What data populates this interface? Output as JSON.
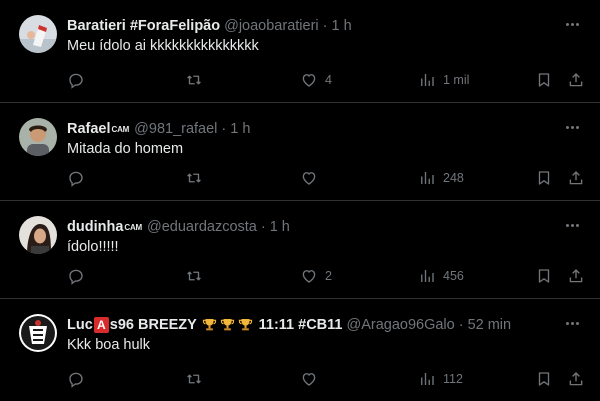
{
  "tweets": [
    {
      "name": "Baratieri #ForaFelipão",
      "badge": "",
      "handle": "@joaobaratieri",
      "separator": "·",
      "time": "1 h",
      "text": "Meu ídolo ai kkkkkkkkkkkkkkk",
      "likes": "4",
      "views": "1 mil",
      "replies": "",
      "retweets": ""
    },
    {
      "name": "Rafael",
      "badge": "CAM",
      "handle": "@981_rafael",
      "separator": "·",
      "time": "1 h",
      "text": "Mitada do homem",
      "likes": "",
      "views": "248",
      "replies": "",
      "retweets": ""
    },
    {
      "name": "dudinha",
      "badge": "CAM",
      "handle": "@eduardazcosta",
      "separator": "·",
      "time": "1 h",
      "text": "ídolo!!!!!",
      "likes": "2",
      "views": "456",
      "replies": "",
      "retweets": ""
    },
    {
      "name_part1": "Luc",
      "name_red_letter": "A",
      "name_part2": "s96 BREEZY",
      "name_part3": "11:11 #CB11",
      "handle": "@Aragao96Galo",
      "separator": "·",
      "time": "52 min",
      "text": "Kkk boa hulk",
      "likes": "",
      "views": "112",
      "replies": "",
      "retweets": ""
    }
  ],
  "icons": {
    "reply": "reply-icon",
    "retweet": "retweet-icon",
    "like": "heart-icon",
    "views": "views-icon",
    "bookmark": "bookmark-icon",
    "share": "share-icon",
    "more": "more-icon",
    "trophy": "trophy-icon"
  },
  "colors": {
    "background": "#000000",
    "text": "#e7e9ea",
    "muted": "#71767b",
    "divider": "#2f3336",
    "red_letter_bg": "#d82b2b",
    "trophy": "#f2b63c"
  }
}
